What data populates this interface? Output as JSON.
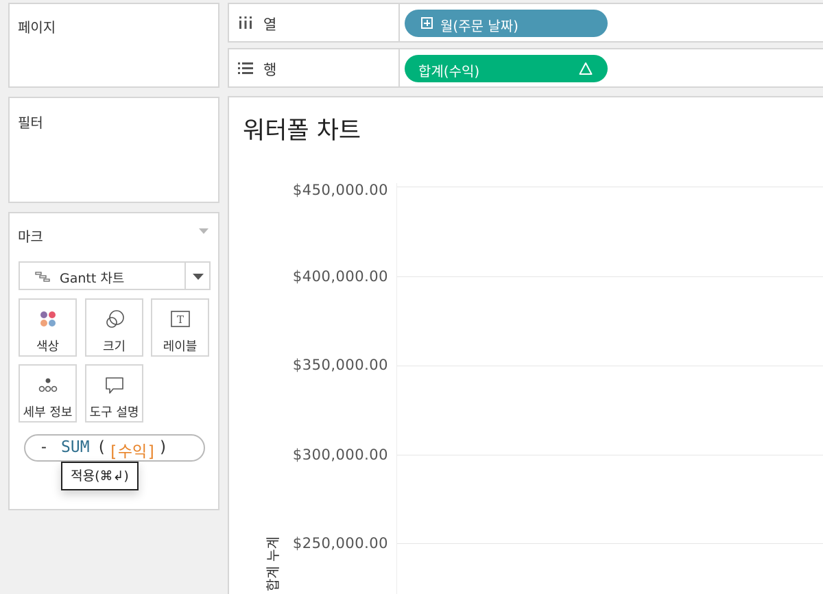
{
  "left_panels": {
    "pages_title": "페이지",
    "filters_title": "필터",
    "marks_title": "마크"
  },
  "marks": {
    "mark_type": "Gantt 차트",
    "cards": {
      "color": "색상",
      "size": "크기",
      "label": "레이블",
      "detail": "세부 정보",
      "tooltip": "도구 설명"
    },
    "calc_editor": {
      "minus": "-",
      "function": "SUM",
      "open_paren": "(",
      "field": "[수익]",
      "close_paren": ")"
    },
    "apply_tooltip": "적용(⌘↲)"
  },
  "shelves": {
    "columns": {
      "label": "열",
      "pill": "월(주문 날짜)"
    },
    "rows": {
      "label": "행",
      "pill": "합계(수익)"
    }
  },
  "viz": {
    "title": "워터폴 차트",
    "y_axis_title": "합계 누계",
    "y_ticks": [
      "$450,000.00",
      "$400,000.00",
      "$350,000.00",
      "$300,000.00",
      "$250,000.00"
    ]
  },
  "colors": {
    "column_pill": "#4a97b3",
    "row_pill": "#00b27a",
    "calc_function": "#2f6f8e",
    "calc_field": "#e8842a"
  }
}
